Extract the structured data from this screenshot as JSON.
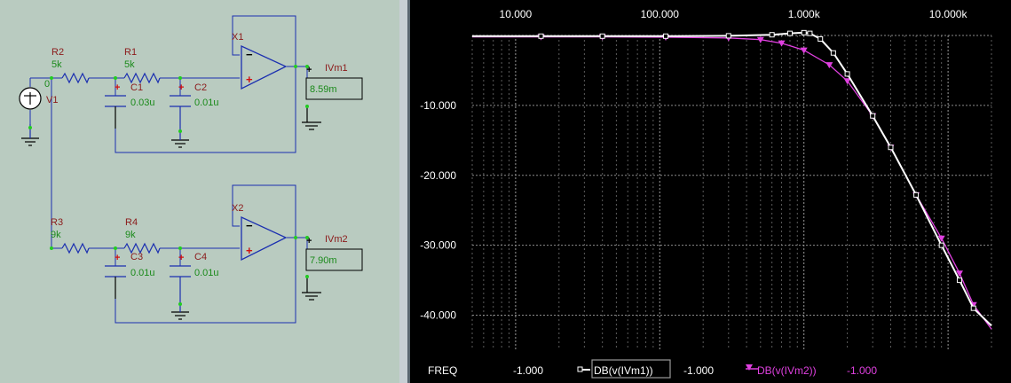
{
  "schematic": {
    "background": "#b9cbc0",
    "wire_color": "#1b2fb0",
    "name_color": "#8b1a1a",
    "value_color": "#1a8a1a",
    "source": {
      "name": "V1",
      "value": "0"
    },
    "resistors": [
      {
        "name": "R2",
        "value": "5k"
      },
      {
        "name": "R1",
        "value": "5k"
      },
      {
        "name": "R3",
        "value": "9k"
      },
      {
        "name": "R4",
        "value": "9k"
      }
    ],
    "capacitors": [
      {
        "name": "C1",
        "value": "0.03u"
      },
      {
        "name": "C2",
        "value": "0.01u"
      },
      {
        "name": "C3",
        "value": "0.01u"
      },
      {
        "name": "C4",
        "value": "0.01u"
      }
    ],
    "opamps": [
      {
        "name": "X1"
      },
      {
        "name": "X2"
      }
    ],
    "meters": [
      {
        "name": "IVm1",
        "reading": "8.59m"
      },
      {
        "name": "IVm2",
        "reading": "7.90m"
      }
    ],
    "plus_sign": "+",
    "minus_sign": "−"
  },
  "plot": {
    "background": "#000000",
    "x_axis_label": "FREQ",
    "cursor_values": [
      "-1.000",
      "-1.000",
      "-1.000"
    ],
    "legend": [
      {
        "label": "DB(v(IVm1))",
        "color": "#ffffff",
        "marker": "square"
      },
      {
        "label": "DB(v(IVm2))",
        "color": "#e040e0",
        "marker": "triangle"
      }
    ]
  },
  "chart_data": {
    "type": "line",
    "xscale": "log",
    "xlim": [
      5,
      20000
    ],
    "ylim": [
      -45,
      0
    ],
    "x_tick_labels": [
      "10.000",
      "100.000",
      "1.000k",
      "10.000k"
    ],
    "x_ticks": [
      10,
      100,
      1000,
      10000
    ],
    "y_tick_labels": [
      "-10.000",
      "-20.000",
      "-30.000",
      "-40.000"
    ],
    "y_ticks": [
      -10,
      -20,
      -30,
      -40
    ],
    "grid": true,
    "series": [
      {
        "name": "DB(v(IVm1))",
        "color": "#ffffff",
        "x": [
          5,
          15,
          40,
          110,
          300,
          600,
          800,
          1000,
          1100,
          1300,
          1600,
          2000,
          3000,
          4000,
          6000,
          9000,
          12000,
          15000,
          20000
        ],
        "y": [
          -0.1,
          -0.1,
          -0.1,
          -0.1,
          -0.05,
          0.1,
          0.3,
          0.4,
          0.3,
          -0.5,
          -2.5,
          -5.5,
          -11.5,
          -16,
          -22.8,
          -30,
          -35,
          -39,
          -41.5
        ]
      },
      {
        "name": "DB(v(IVm2))",
        "color": "#e040e0",
        "x": [
          5,
          15,
          40,
          110,
          300,
          500,
          700,
          1000,
          1500,
          2000,
          3000,
          4000,
          6000,
          9000,
          12000,
          15000,
          20000
        ],
        "y": [
          -0.2,
          -0.2,
          -0.2,
          -0.25,
          -0.35,
          -0.6,
          -1.1,
          -2.1,
          -4.2,
          -6.5,
          -11.5,
          -16,
          -22.8,
          -29,
          -34,
          -38.5,
          -42
        ]
      }
    ]
  }
}
